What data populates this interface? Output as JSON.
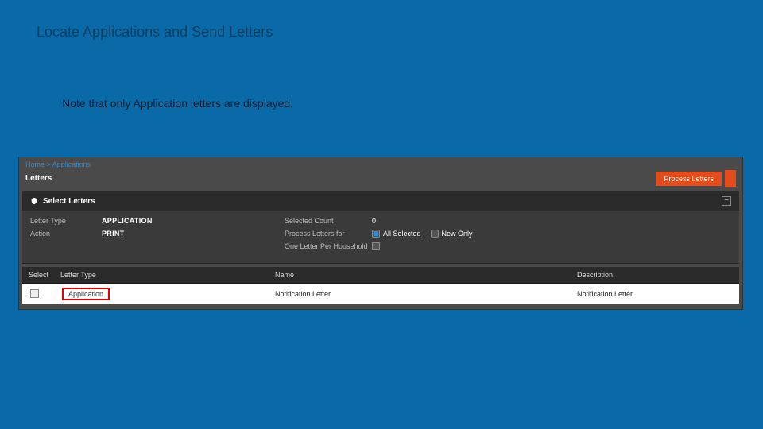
{
  "slide": {
    "title": "Locate Applications and Send Letters",
    "note": "Note that only Application letters are displayed."
  },
  "app": {
    "breadcrumb": "Home > Applications",
    "page_title": "Letters",
    "process_button": "Process Letters",
    "section_title": "Select Letters",
    "collapse_glyph": "−",
    "filters": {
      "letter_type_label": "Letter Type",
      "letter_type_value": "APPLICATION",
      "action_label": "Action",
      "action_value": "PRINT",
      "selected_count_label": "Selected Count",
      "selected_count_value": "0",
      "process_for_label": "Process Letters for",
      "process_for_options": {
        "all": "All Selected",
        "new": "New Only"
      },
      "one_per_hh_label": "One Letter Per Household"
    },
    "table": {
      "headers": {
        "select": "Select",
        "type": "Letter Type",
        "name": "Name",
        "desc": "Description"
      },
      "row": {
        "type": "Application",
        "name": "Notification Letter",
        "desc": "Notification Letter"
      }
    }
  }
}
